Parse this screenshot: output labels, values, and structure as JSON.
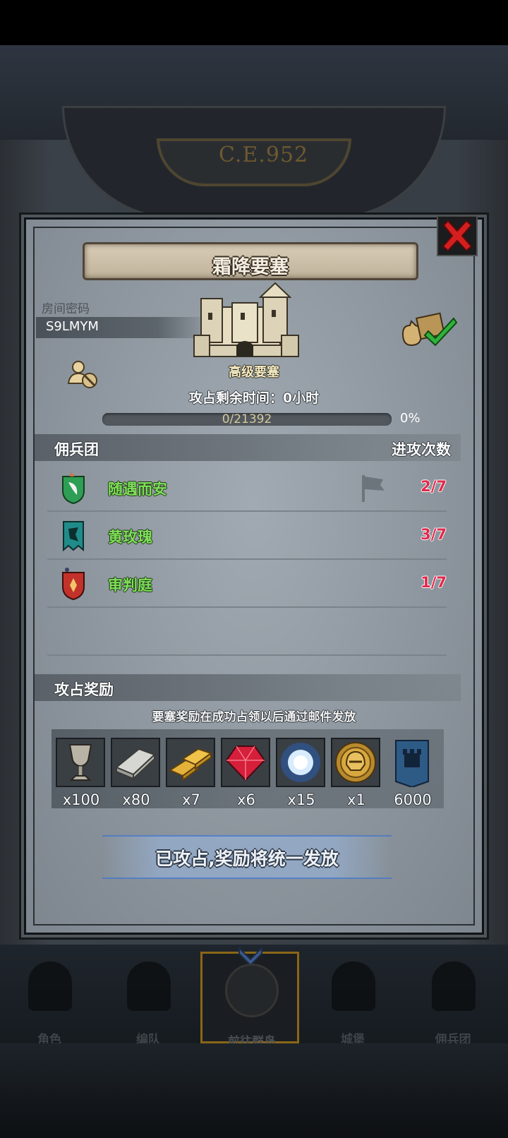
{
  "background": {
    "era_label": "C.E.952"
  },
  "dialog": {
    "title": "霜降要塞",
    "room_code_label": "房间密码",
    "room_code": "S9LMYM",
    "fortress_level": "高级要塞",
    "occupy_time_text": "攻占剩余时间：0小时",
    "progress": {
      "text": "0/21392",
      "current": 0,
      "total": 21392,
      "percent_label": "0%",
      "fill_color": "#c8a656"
    },
    "mercenary_section": {
      "title": "佣兵团",
      "attack_count_header": "进攻次数",
      "rows": [
        {
          "name": "随遇而安",
          "count": "2/7",
          "emblem": "green-white-shield-emblem",
          "emblem_color": "#2e9e54",
          "flag_icon": true
        },
        {
          "name": "黄玫瑰",
          "count": "3/7",
          "emblem": "teal-banner-emblem",
          "emblem_color": "#1f8c8a",
          "flag_icon": false
        },
        {
          "name": "审判庭",
          "count": "1/7",
          "emblem": "red-shield-emblem",
          "emblem_color": "#c2322a",
          "flag_icon": false
        }
      ]
    },
    "reward_section": {
      "title": "攻占奖励",
      "note": "要塞奖励在成功占领以后通过邮件发放",
      "items": [
        {
          "icon": "goblet-icon",
          "qty": "x100"
        },
        {
          "icon": "silver-ingot-icon",
          "qty": "x80"
        },
        {
          "icon": "gold-bars-icon",
          "qty": "x7"
        },
        {
          "icon": "ruby-gem-icon",
          "qty": "x6"
        },
        {
          "icon": "blue-crystal-icon",
          "qty": "x15"
        },
        {
          "icon": "golden-helmet-medal-icon",
          "qty": "x1"
        },
        {
          "icon": "fortress-banner-icon",
          "qty": "6000"
        }
      ]
    },
    "status_button": "已攻占,奖励将统一发放"
  },
  "bottom_nav": {
    "items": [
      {
        "label": "角色",
        "icon": "knight-icon"
      },
      {
        "label": "编队",
        "icon": "formation-icon"
      },
      {
        "label": "前往群岛",
        "icon": "compass-icon",
        "active": true
      },
      {
        "label": "城堡",
        "icon": "castle-icon"
      },
      {
        "label": "佣兵团",
        "icon": "mercenary-icon"
      }
    ]
  },
  "colors": {
    "accent_gold": "#8a6616",
    "merc_name_green": "#7ee05a",
    "count_red": "#e0294b"
  }
}
